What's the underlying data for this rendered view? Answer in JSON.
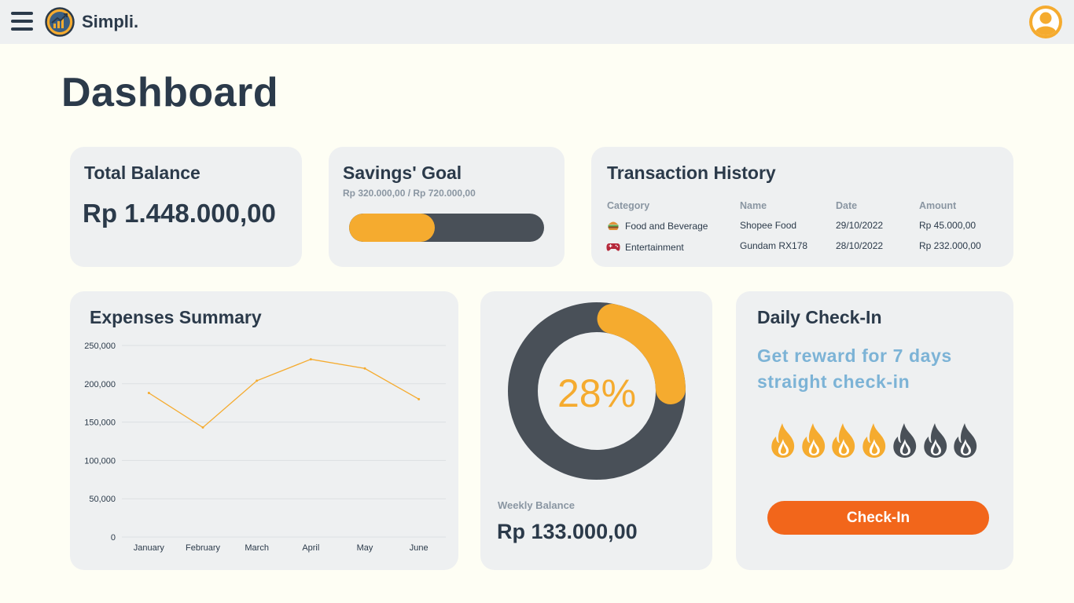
{
  "app": {
    "brand": "Simpli."
  },
  "page": {
    "title": "Dashboard"
  },
  "total_balance": {
    "title": "Total Balance",
    "amount": "Rp 1.448.000,00"
  },
  "savings_goal": {
    "title": "Savings' Goal",
    "progress_text": "Rp 320.000,00 / Rp 720.000,00",
    "progress_fraction": 0.44,
    "fill_color": "#f5ab2f",
    "track_color": "#495058"
  },
  "transactions": {
    "title": "Transaction History",
    "columns": [
      "Category",
      "Name",
      "Date",
      "Amount"
    ],
    "rows": [
      {
        "icon": "burger-icon",
        "category": "Food and Beverage",
        "name": "Shopee Food",
        "date": "29/10/2022",
        "amount": "Rp 45.000,00"
      },
      {
        "icon": "gamepad-icon",
        "category": "Entertainment",
        "name": "Gundam RX178",
        "date": "28/10/2022",
        "amount": "Rp 232.000,00"
      }
    ]
  },
  "expenses": {
    "title": "Expenses Summary"
  },
  "chart_data": {
    "type": "line",
    "title": "",
    "xlabel": "",
    "ylabel": "",
    "categories": [
      "January",
      "February",
      "March",
      "April",
      "May",
      "June"
    ],
    "values": [
      188000,
      143000,
      204000,
      232000,
      220000,
      180000
    ],
    "ylim": [
      0,
      250000
    ],
    "yticks": [
      "0",
      "50,000",
      "100,000",
      "150,000",
      "200,000",
      "250,000"
    ],
    "grid": true,
    "line_color": "#f5ab2f"
  },
  "weekly": {
    "percent_label": "28%",
    "percent": 28,
    "label": "Weekly Balance",
    "amount": "Rp 133.000,00",
    "ring_color": "#495058",
    "accent_color": "#f5ab2f"
  },
  "checkin": {
    "title": "Daily Check-In",
    "subtitle": "Get reward for 7 days straight check-in",
    "days_total": 7,
    "days_completed": 4,
    "active_color": "#f5ab2f",
    "inactive_color": "#495058",
    "button_label": "Check-In",
    "button_color": "#f2661b"
  }
}
